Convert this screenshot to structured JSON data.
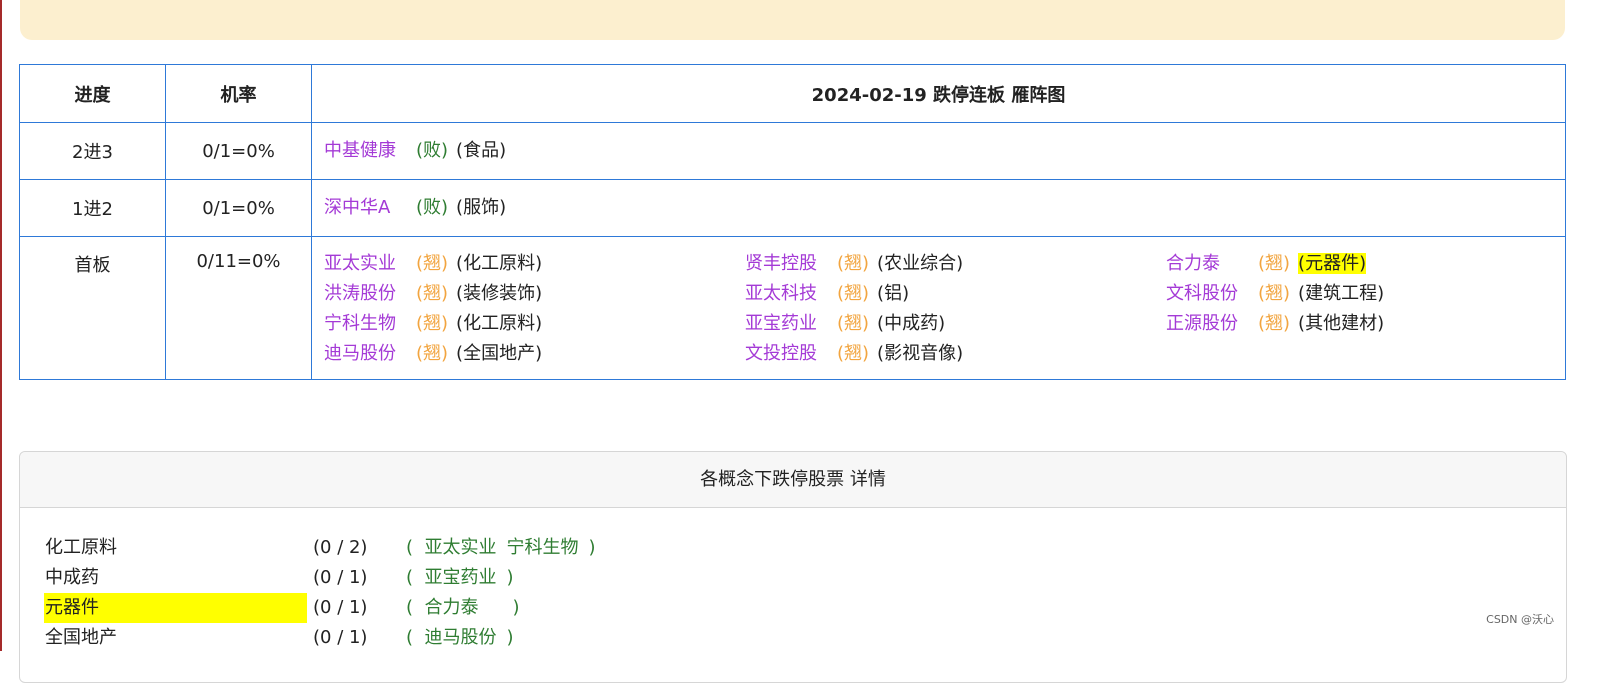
{
  "table": {
    "headers": [
      "进度",
      "机率",
      "2024-02-19 跌停连板 雁阵图"
    ],
    "rows": [
      {
        "stage": "2进3",
        "rate": "0/1=0%",
        "stocks": [
          {
            "name": "中基健康",
            "status": "(败)",
            "concept": "(食品)"
          }
        ]
      },
      {
        "stage": "1进2",
        "rate": "0/1=0%",
        "stocks": [
          {
            "name": "深中华A",
            "status": "(败)",
            "concept": "(服饰)"
          }
        ]
      },
      {
        "stage": "首板",
        "rate": "0/11=0%",
        "stocks": [
          {
            "name": "亚太实业",
            "status": "(翘)",
            "concept": "(化工原料)"
          },
          {
            "name": "贤丰控股",
            "status": "(翘)",
            "concept": "(农业综合)"
          },
          {
            "name": "合力泰",
            "status": "(翘)",
            "concept": "(元器件)"
          },
          {
            "name": "洪涛股份",
            "status": "(翘)",
            "concept": "(装修装饰)"
          },
          {
            "name": "亚太科技",
            "status": "(翘)",
            "concept": "(铝)"
          },
          {
            "name": "文科股份",
            "status": "(翘)",
            "concept": "(建筑工程)"
          },
          {
            "name": "宁科生物",
            "status": "(翘)",
            "concept": "(化工原料)"
          },
          {
            "name": "亚宝药业",
            "status": "(翘)",
            "concept": "(中成药)"
          },
          {
            "name": "正源股份",
            "status": "(翘)",
            "concept": "(其他建材)"
          },
          {
            "name": "迪马股份",
            "status": "(翘)",
            "concept": "(全国地产)"
          },
          {
            "name": "文投控股",
            "status": "(翘)",
            "concept": "(影视音像)"
          }
        ]
      }
    ]
  },
  "concept_panel": {
    "title": "各概念下跌停股票 详情",
    "rows": [
      {
        "name": "化工原料",
        "count": "(0 / 2)",
        "open": "(",
        "stocks": [
          "亚太实业",
          "宁科生物"
        ],
        "close": ")"
      },
      {
        "name": "中成药",
        "count": "(0 / 1)",
        "open": "(",
        "stocks": [
          "亚宝药业"
        ],
        "close": ")"
      },
      {
        "name": "元器件",
        "count": "(0 / 1)",
        "open": "(",
        "stocks": [
          "合力泰"
        ],
        "close": ")"
      },
      {
        "name": "全国地产",
        "count": "(0 / 1)",
        "open": "(",
        "stocks": [
          "迪马股份"
        ],
        "close": ")"
      }
    ]
  },
  "watermark": "CSDN @沃心",
  "colors": {
    "table_border": "#2e79d8",
    "stock_name": "#a43ad6",
    "status_fail": "#2f7d32",
    "status_rise": "#f2a540",
    "highlight": "#ffff00",
    "banner": "#fcefcf"
  }
}
